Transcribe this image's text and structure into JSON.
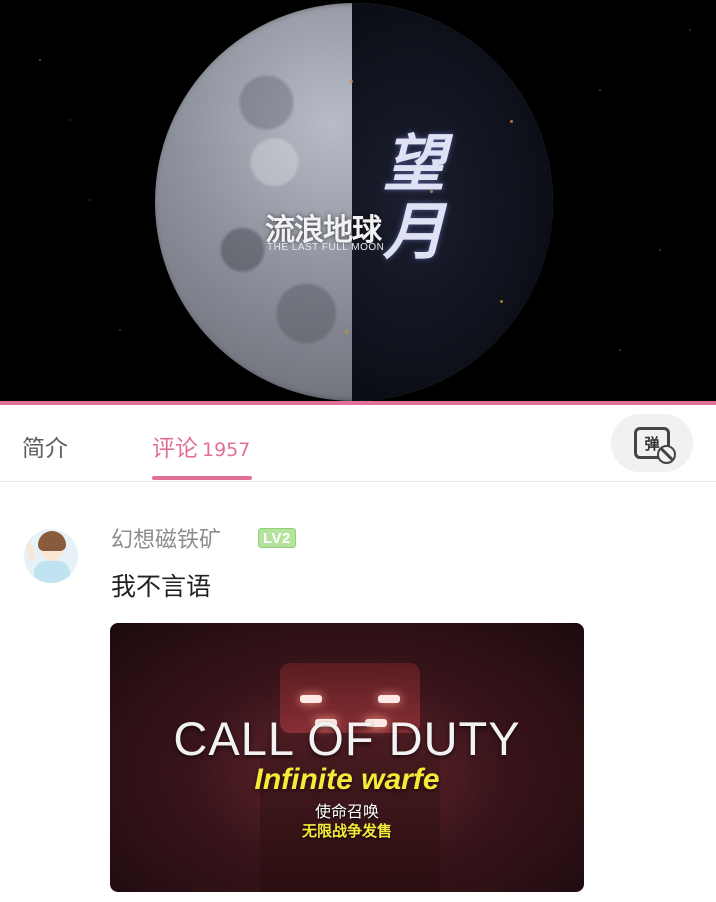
{
  "video": {
    "title_cn": "流浪地球",
    "title_en": "THE LAST FULL MOON",
    "title_stylized": "望月"
  },
  "tabs": {
    "intro_label": "简介",
    "comments_label": "评论",
    "comments_count": "1957",
    "danmaku_glyph": "弹",
    "accent_color": "#e0709a"
  },
  "comment": {
    "username": "幻想磁铁矿",
    "level": "LV2",
    "text": "我不言语",
    "image": {
      "headline": "CALL OF DUTY",
      "subline": "Infinite warfe",
      "cn_line1": "使命召唤",
      "cn_line2": "无限战争发售"
    }
  }
}
